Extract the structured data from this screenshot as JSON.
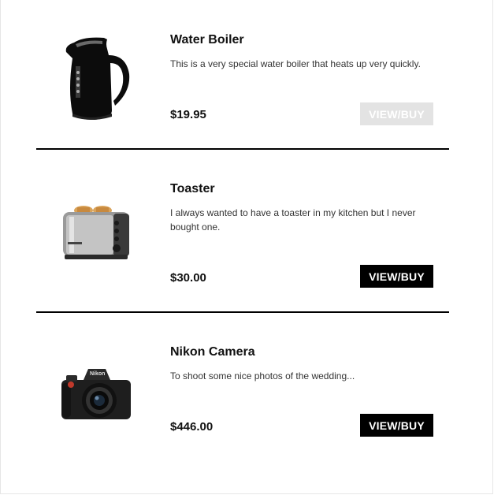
{
  "products": [
    {
      "name": "Water Boiler",
      "description": "This is a very special water boiler that heats up very quickly.",
      "price": "$19.95",
      "button_label": "VIEW/BUY",
      "image_icon": "kettle-icon"
    },
    {
      "name": "Toaster",
      "description": "I always wanted to have a toaster in my kitchen but I never bought one.",
      "price": "$30.00",
      "button_label": "VIEW/BUY",
      "image_icon": "toaster-icon"
    },
    {
      "name": "Nikon Camera",
      "description": "To shoot some nice photos of the wedding...",
      "price": "$446.00",
      "button_label": "VIEW/BUY",
      "image_icon": "camera-icon"
    }
  ],
  "camera_brand": "Nikon",
  "colors": {
    "button_bg": "#000000",
    "button_bg_light": "#e3e3e3",
    "divider": "#000000"
  }
}
